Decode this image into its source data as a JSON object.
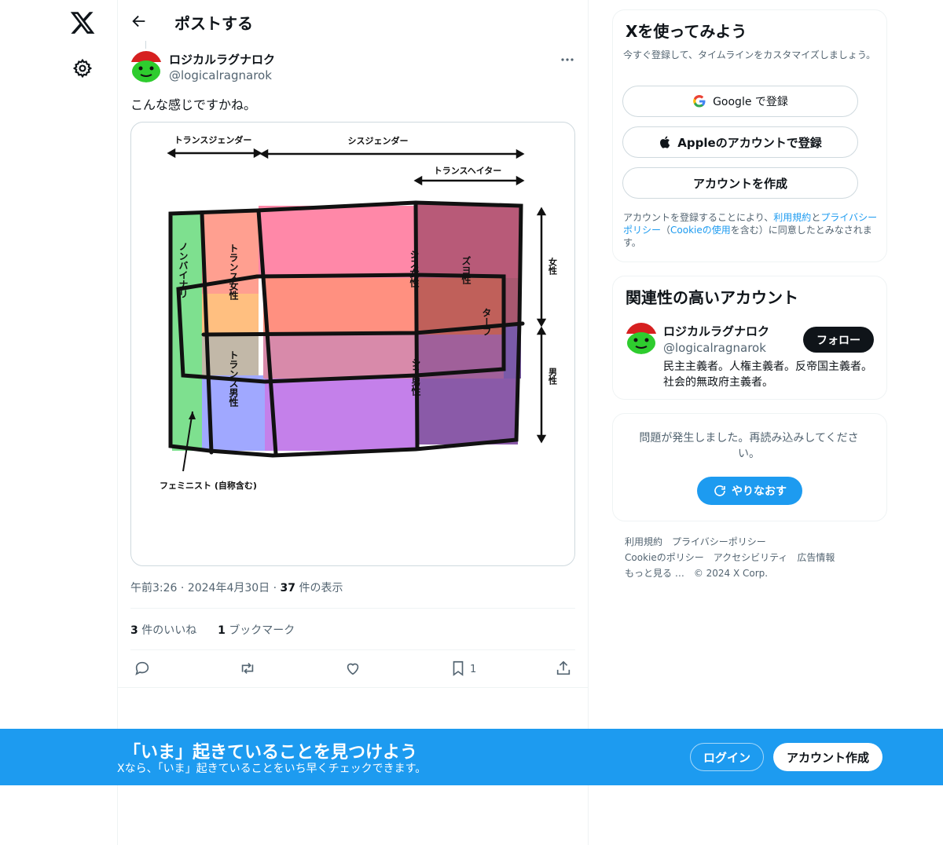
{
  "header": {
    "title": "ポストする"
  },
  "tweet": {
    "author_name": "ロジカルラグナロク",
    "author_handle": "@logicalragnarok",
    "text": "こんな感じですかね。",
    "time": "午前3:26",
    "date": "2024年4月30日",
    "views_count": "37",
    "views_label": "件の表示",
    "likes_count": "3",
    "likes_label": "件のいいね",
    "bookmarks_count": "1",
    "bookmarks_label": "ブックマーク",
    "bookmark_action_count": "1",
    "image": {
      "labels": {
        "transgender": "トランスジェンダー",
        "cisgender": "シスジェンダー",
        "trans_hater": "トランスヘイター",
        "nonbinary": "ノンバイナリ",
        "trans_female": "トランス女性",
        "trans_male": "トランス男性",
        "cis_female": "シス女性",
        "cis_male": "シス男性",
        "zuyo": "ズヨ性",
        "terf": "ターフ",
        "female": "女性",
        "male": "男性",
        "feminist": "フェミニスト (自称含む)"
      }
    }
  },
  "signup_card": {
    "title": "Xを使ってみよう",
    "subtitle": "今すぐ登録して、タイムラインをカスタマイズしましょう。",
    "google_label": "Google で登録",
    "apple_label": "Appleのアカウントで登録",
    "create_label": "アカウントを作成",
    "legal_prefix": "アカウントを登録することにより、",
    "terms": "利用規約",
    "and": "と",
    "privacy": "プライバシーポリシー",
    "legal_mid": "（",
    "cookie": "Cookieの使用",
    "legal_suffix": "を含む）に同意したとみなされます。"
  },
  "related": {
    "title": "関連性の高いアカウント",
    "name": "ロジカルラグナロク",
    "handle": "@logicalragnarok",
    "bio": "民主主義者。人権主義者。反帝国主義者。社会的無政府主義者。",
    "follow_label": "フォロー"
  },
  "error_card": {
    "message": "問題が発生しました。再読み込みしてください。",
    "retry_label": "やりなおす"
  },
  "footer": {
    "links": [
      "利用規約",
      "プライバシーポリシー",
      "Cookieのポリシー",
      "アクセシビリティ",
      "広告情報",
      "もっと見る …",
      "© 2024 X Corp."
    ]
  },
  "banner": {
    "title": "「いま」起きていることを見つけよう",
    "subtitle": "Xなら、「いま」起きていることをいち早くチェックできます。",
    "login_label": "ログイン",
    "signup_label": "アカウント作成"
  },
  "colors": {
    "accent": "#1d9bf0",
    "text": "#0f1419",
    "muted": "#536471"
  }
}
